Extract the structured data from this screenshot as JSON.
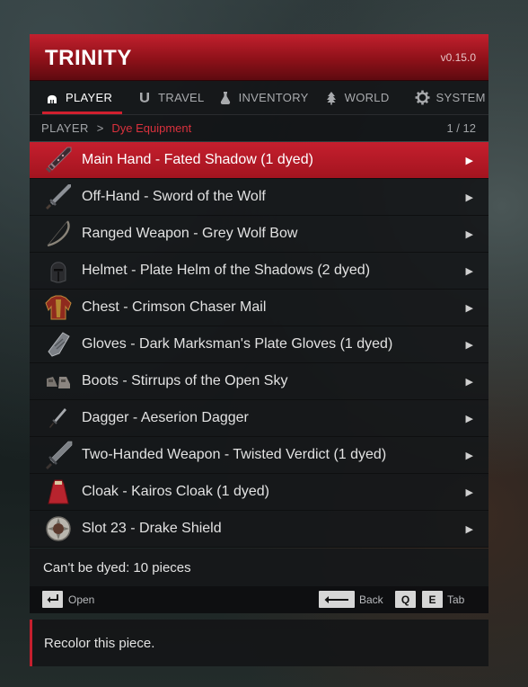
{
  "header": {
    "title": "TRINITY",
    "version": "v0.15.0"
  },
  "tabs": [
    {
      "label": "PLAYER",
      "icon": "helmet-icon",
      "active": true
    },
    {
      "label": "TRAVEL",
      "icon": "horseshoe-icon",
      "active": false
    },
    {
      "label": "INVENTORY",
      "icon": "potion-flask-icon",
      "active": false
    },
    {
      "label": "WORLD",
      "icon": "tree-icon",
      "active": false
    },
    {
      "label": "SYSTEM",
      "icon": "gear-icon",
      "active": false
    }
  ],
  "breadcrumb": {
    "root": "PLAYER",
    "separator": ">",
    "current": "Dye Equipment",
    "page": "1 / 12"
  },
  "items": [
    {
      "label": "Main Hand - Fated Shadow  (1 dyed)",
      "icon": "dark-sword-icon",
      "selected": true
    },
    {
      "label": "Off-Hand - Sword of the Wolf",
      "icon": "sword-icon",
      "selected": false
    },
    {
      "label": "Ranged Weapon - Grey Wolf Bow",
      "icon": "bow-icon",
      "selected": false
    },
    {
      "label": "Helmet - Plate Helm of the Shadows  (2 dyed)",
      "icon": "helm-icon",
      "selected": false
    },
    {
      "label": "Chest - Crimson Chaser Mail",
      "icon": "chest-armor-icon",
      "selected": false
    },
    {
      "label": "Gloves - Dark Marksman's Plate Gloves  (1 dyed)",
      "icon": "gloves-icon",
      "selected": false
    },
    {
      "label": "Boots - Stirrups of the Open Sky",
      "icon": "boots-icon",
      "selected": false
    },
    {
      "label": "Dagger - Aeserion Dagger",
      "icon": "dagger-icon",
      "selected": false
    },
    {
      "label": "Two-Handed Weapon - Twisted Verdict  (1 dyed)",
      "icon": "greatsword-icon",
      "selected": false
    },
    {
      "label": "Cloak - Kairos Cloak  (1 dyed)",
      "icon": "cloak-icon",
      "selected": false
    },
    {
      "label": "Slot 23 - Drake Shield",
      "icon": "shield-icon",
      "selected": false
    }
  ],
  "row_arrow": "▶",
  "note": "Can't be dyed: 10 pieces",
  "footer": {
    "open_label": "Open",
    "back_label": "Back",
    "q_key": "Q",
    "e_key": "E",
    "tab_label": "Tab"
  },
  "description": "Recolor this piece.",
  "colors": {
    "accent": "#c51f2e",
    "panel": "#16181a",
    "text": "#e2e2e2"
  }
}
